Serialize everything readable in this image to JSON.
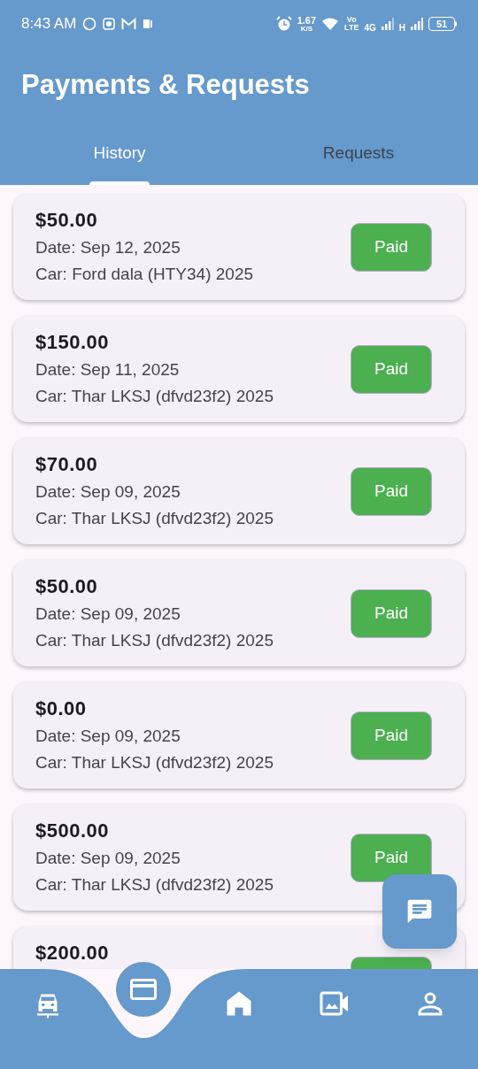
{
  "status_bar": {
    "time": "8:43 AM",
    "speed": "1.67",
    "speed_unit": "K/S",
    "volte_top": "Vo",
    "volte_bottom": "LTE",
    "network_1": "4G",
    "network_2": "H",
    "battery": "51"
  },
  "header": {
    "title": "Payments & Requests"
  },
  "tabs": [
    {
      "label": "History",
      "selected": true
    },
    {
      "label": "Requests",
      "selected": false
    }
  ],
  "payments": [
    {
      "amount": "$50.00",
      "date": "Date: Sep 12, 2025",
      "car": "Car: Ford dala (HTY34) 2025",
      "status": "Paid"
    },
    {
      "amount": "$150.00",
      "date": "Date: Sep 11, 2025",
      "car": "Car: Thar LKSJ (dfvd23f2) 2025",
      "status": "Paid"
    },
    {
      "amount": "$70.00",
      "date": "Date: Sep 09, 2025",
      "car": "Car: Thar LKSJ (dfvd23f2) 2025",
      "status": "Paid"
    },
    {
      "amount": "$50.00",
      "date": "Date: Sep 09, 2025",
      "car": "Car: Thar LKSJ (dfvd23f2) 2025",
      "status": "Paid"
    },
    {
      "amount": "$0.00",
      "date": "Date: Sep 09, 2025",
      "car": "Car: Thar LKSJ (dfvd23f2) 2025",
      "status": "Paid"
    },
    {
      "amount": "$500.00",
      "date": "Date: Sep 09, 2025",
      "car": "Car: Thar LKSJ (dfvd23f2) 2025",
      "status": "Paid"
    },
    {
      "amount": "$200.00"
    }
  ],
  "bottom_nav": [
    {
      "kind": "car",
      "selected": false
    },
    {
      "kind": "card",
      "selected": true
    },
    {
      "kind": "home",
      "selected": false
    },
    {
      "kind": "media",
      "selected": false
    },
    {
      "kind": "profile",
      "selected": false
    }
  ]
}
